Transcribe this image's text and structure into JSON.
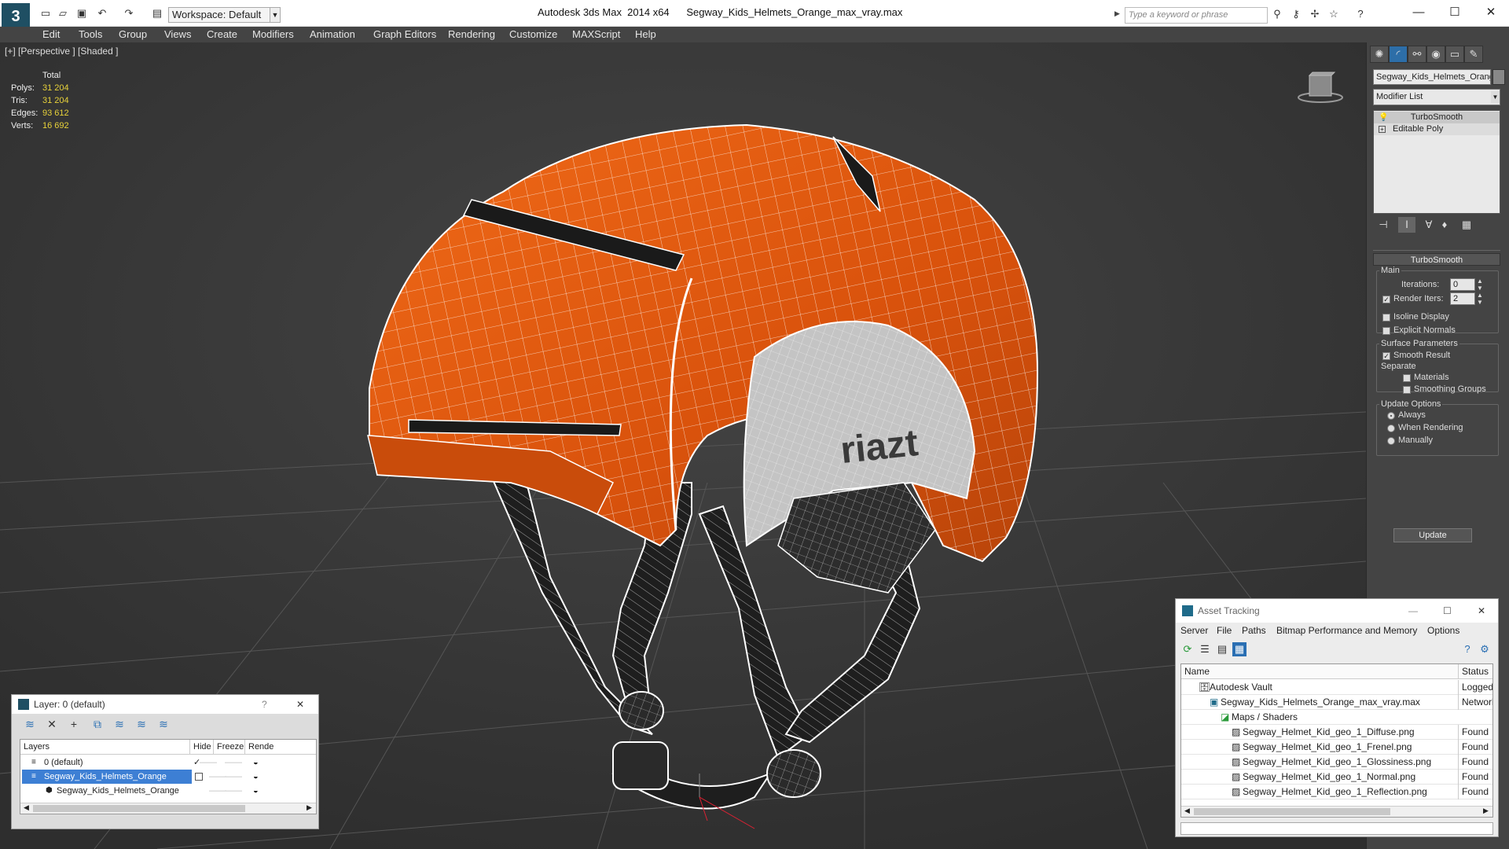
{
  "titlebar": {
    "app_title": "Autodesk 3ds Max  2014 x64      Segway_Kids_Helmets_Orange_max_vray.max",
    "workspace": "Workspace: Default",
    "search_placeholder": "Type a keyword or phrase",
    "logo_glyph": "3"
  },
  "menu": [
    "Edit",
    "Tools",
    "Group",
    "Views",
    "Create",
    "Modifiers",
    "Animation",
    "Graph Editors",
    "Rendering",
    "Customize",
    "MAXScript",
    "Help"
  ],
  "viewport": {
    "label": "[+] [Perspective ] [Shaded ]",
    "stats": {
      "header": "Total",
      "rows": [
        {
          "label": "Polys:",
          "value": "31 204"
        },
        {
          "label": "Tris:",
          "value": "31 204"
        },
        {
          "label": "Edges:",
          "value": "93 612"
        },
        {
          "label": "Verts:",
          "value": "16 692"
        }
      ]
    },
    "helmet_text": "riazt",
    "colors": {
      "shell": "#e0580e",
      "shell_dark": "#b8440a",
      "padding": "#bdbdbd",
      "strap": "#1e1e1e",
      "background": "#3b3b3b"
    }
  },
  "command_panel": {
    "object_name": "Segway_Kids_Helmets_Orange",
    "modifier_list": "Modifier List",
    "stack": [
      "TurboSmooth",
      "Editable Poly"
    ],
    "rollout_title": "TurboSmooth",
    "main_label": "Main",
    "iterations_label": "Iterations:",
    "iterations_value": "0",
    "render_iters_label": "Render Iters:",
    "render_iters_value": "2",
    "render_iters_checked": true,
    "isoline_label": "Isoline Display",
    "explicit_normals_label": "Explicit Normals",
    "surface_label": "Surface Parameters",
    "smooth_result_label": "Smooth Result",
    "separate_label": "Separate",
    "materials_label": "Materials",
    "smoothing_groups_label": "Smoothing Groups",
    "update_options_label": "Update Options",
    "always_label": "Always",
    "when_rendering_label": "When Rendering",
    "manually_label": "Manually",
    "update_button": "Update",
    "selected_update_option": "Always"
  },
  "layer_panel": {
    "title": "Layer: 0 (default)",
    "help": "?",
    "close": "✕",
    "headers": {
      "layers": "Layers",
      "hide": "Hide",
      "freeze": "Freeze",
      "render": "Rende"
    },
    "rows": [
      {
        "name": "0 (default)",
        "selected": false
      },
      {
        "name": "Segway_Kids_Helmets_Orange",
        "selected": true
      },
      {
        "name": "Segway_Kids_Helmets_Orange",
        "selected": false
      }
    ],
    "dash": "——"
  },
  "asset_panel": {
    "title": "Asset Tracking",
    "menu": [
      "Server",
      "File",
      "Paths",
      "Bitmap Performance and Memory",
      "Options"
    ],
    "headers": {
      "name": "Name",
      "status": "Status"
    },
    "rows": [
      {
        "name": "Autodesk Vault",
        "status": "Logged O",
        "indent": 1
      },
      {
        "name": "Segway_Kids_Helmets_Orange_max_vray.max",
        "status": "Network P",
        "indent": 2
      },
      {
        "name": "Maps / Shaders",
        "status": "",
        "indent": 3
      },
      {
        "name": "Segway_Helmet_Kid_geo_1_Diffuse.png",
        "status": "Found",
        "indent": 4
      },
      {
        "name": "Segway_Helmet_Kid_geo_1_Frenel.png",
        "status": "Found",
        "indent": 4
      },
      {
        "name": "Segway_Helmet_Kid_geo_1_Glossiness.png",
        "status": "Found",
        "indent": 4
      },
      {
        "name": "Segway_Helmet_Kid_geo_1_Normal.png",
        "status": "Found",
        "indent": 4
      },
      {
        "name": "Segway_Helmet_Kid_geo_1_Reflection.png",
        "status": "Found",
        "indent": 4
      }
    ]
  }
}
